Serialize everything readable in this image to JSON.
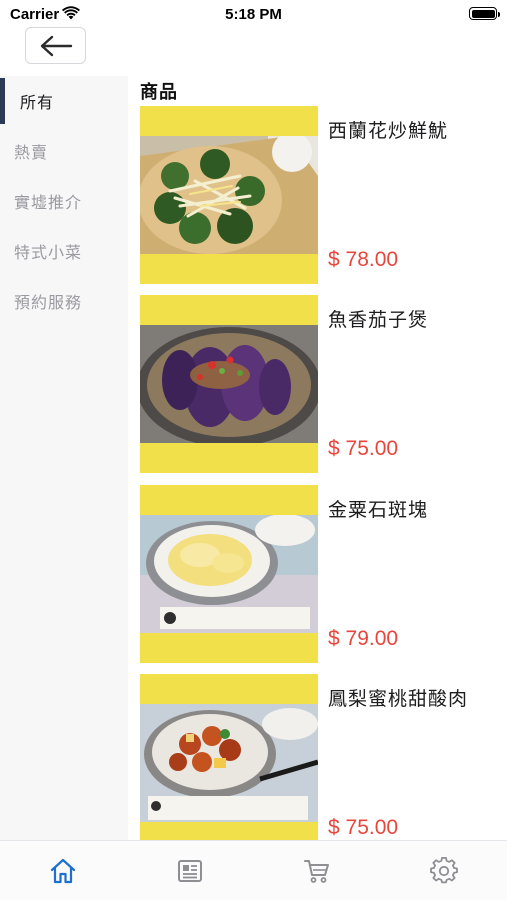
{
  "status_bar": {
    "carrier": "Carrier",
    "time": "5:18 PM",
    "battery_level": 1.0
  },
  "header": {
    "back_icon": "arrow-left-icon"
  },
  "sidebar": {
    "items": [
      {
        "label": "所有",
        "active": true
      },
      {
        "label": "熱賣",
        "active": false
      },
      {
        "label": "實墟推介",
        "active": false
      },
      {
        "label": "特式小菜",
        "active": false
      },
      {
        "label": "預約服務",
        "active": false
      }
    ]
  },
  "main": {
    "section_title": "商品",
    "products": [
      {
        "name": "西蘭花炒鮮魷",
        "price": "$ 78.00"
      },
      {
        "name": "魚香茄子煲",
        "price": "$ 75.00"
      },
      {
        "name": "金粟石斑塊",
        "price": "$ 79.00"
      },
      {
        "name": "鳳梨蜜桃甜酸肉",
        "price": "$ 75.00"
      }
    ]
  },
  "tab_bar": {
    "tabs": [
      {
        "icon": "home-icon",
        "active": true
      },
      {
        "icon": "news-icon",
        "active": false
      },
      {
        "icon": "cart-icon",
        "active": false
      },
      {
        "icon": "settings-icon",
        "active": false
      }
    ]
  },
  "colors": {
    "accent": "#1f6fd1",
    "price": "#e8463c",
    "image_bg": "#f1e04a",
    "sidebar_indicator": "#2c3a55",
    "inactive_icon": "#8e8e93"
  }
}
